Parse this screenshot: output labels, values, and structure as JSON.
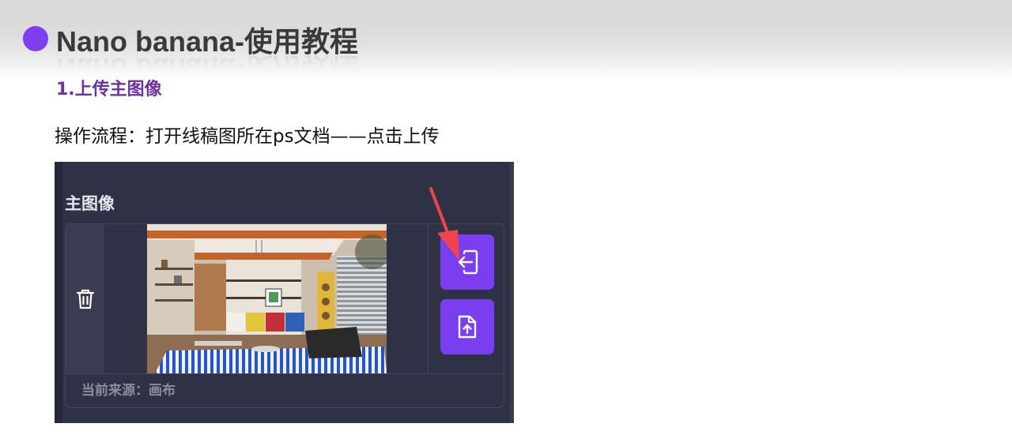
{
  "header": {
    "title": "Nano banana-使用教程",
    "subtitle": "1.上传主图像",
    "accent_color": "#7f3df0",
    "subtitle_color": "#7030a0"
  },
  "body": {
    "instruction": "操作流程：打开线稿图所在ps文档——点击上传"
  },
  "screenshot": {
    "panel_label": "主图像",
    "source_text": "当前来源：画布",
    "buttons": [
      {
        "icon": "import-icon",
        "action": "upload"
      },
      {
        "icon": "file-upload-icon",
        "action": "upload-file"
      }
    ],
    "delete_icon": "trash-icon",
    "image_desc_icon": "interior-photo",
    "button_color": "#7a3ef0",
    "annotation_arrow_color": "#f0444d"
  }
}
